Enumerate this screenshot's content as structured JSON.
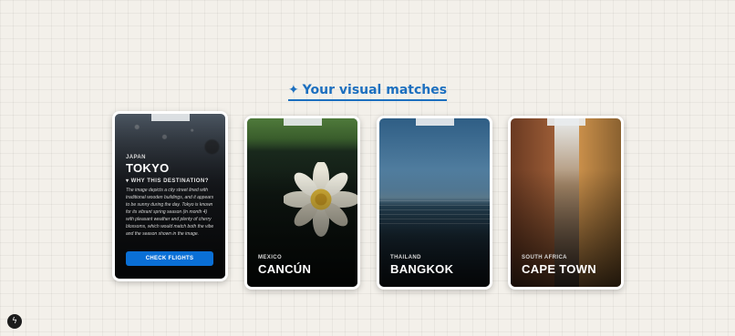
{
  "heading": {
    "sparkle": "✦",
    "title": "Your visual matches"
  },
  "cards": [
    {
      "country": "JAPAN",
      "city": "TOKYO",
      "why_title": "▾ WHY THIS DESTINATION?",
      "description": "The image depicts a city street lined with traditional wooden buildings, and it appears to be sunny during the day. Tokyo is known for its vibrant spring season (in month 4) with pleasant weather and plenty of cherry blossoms, which would match both the vibe and the season shown in the image.",
      "cta": "CHECK FLIGHTS"
    },
    {
      "country": "MEXICO",
      "city": "CANCÚN"
    },
    {
      "country": "THAILAND",
      "city": "BANGKOK"
    },
    {
      "country": "SOUTH AFRICA",
      "city": "CAPE TOWN"
    }
  ],
  "badge_icon": "lightning-icon"
}
